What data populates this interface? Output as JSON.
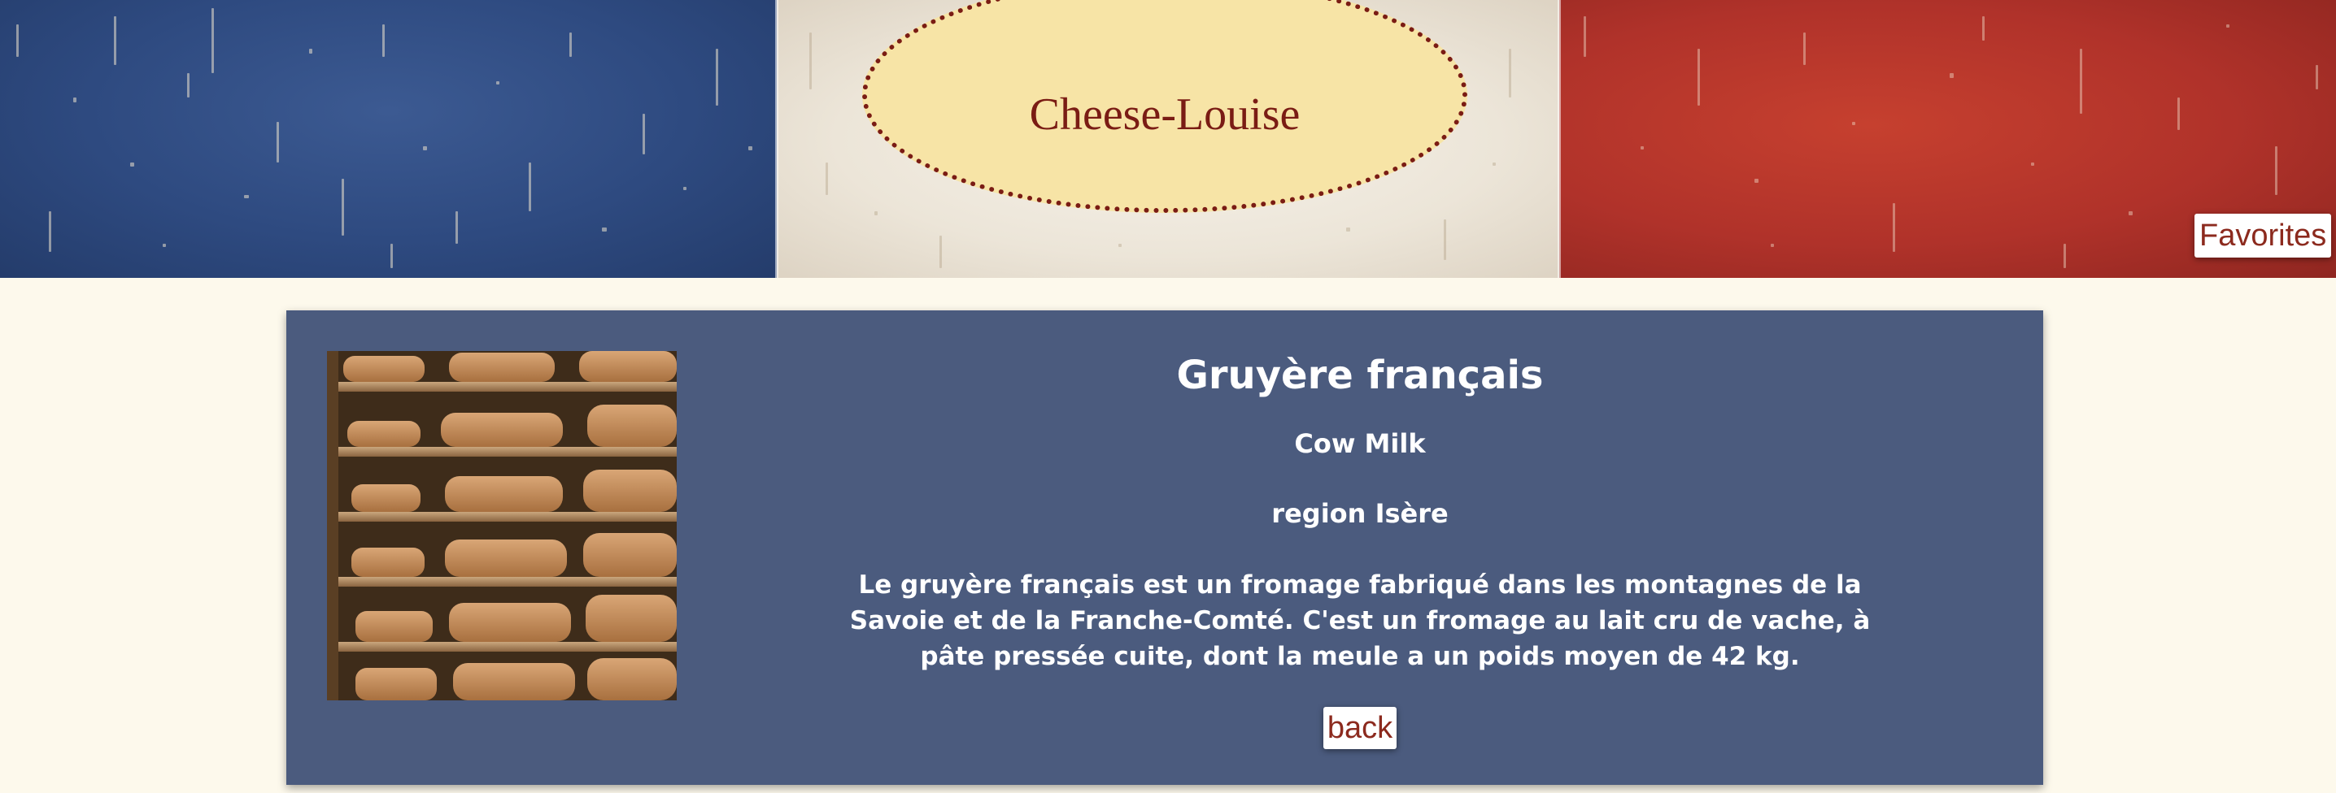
{
  "header": {
    "logo_text": "Cheese-Louise",
    "favorites_label": "Favorites",
    "flag_colors": {
      "blue": "#2e4a80",
      "white": "#ece5d8",
      "red": "#b0322a"
    }
  },
  "cheese": {
    "name": "Gruyère français",
    "milk": "Cow Milk",
    "region": "region Isère",
    "description": "Le gruyère français est un fromage fabriqué dans les montagnes de la Savoie et de la Franche-Comté. C'est un fromage au lait cru de vache, à pâte pressée cuite, dont la meule a un poids moyen de 42 kg.",
    "image_subject": "cheese-wheels-on-shelves"
  },
  "actions": {
    "back_label": "back"
  },
  "colors": {
    "card_bg": "#4b5b7e",
    "page_bg": "#fdf9ec",
    "accent_text": "#8c2a1e",
    "logo_fill": "#f7e4a6"
  }
}
